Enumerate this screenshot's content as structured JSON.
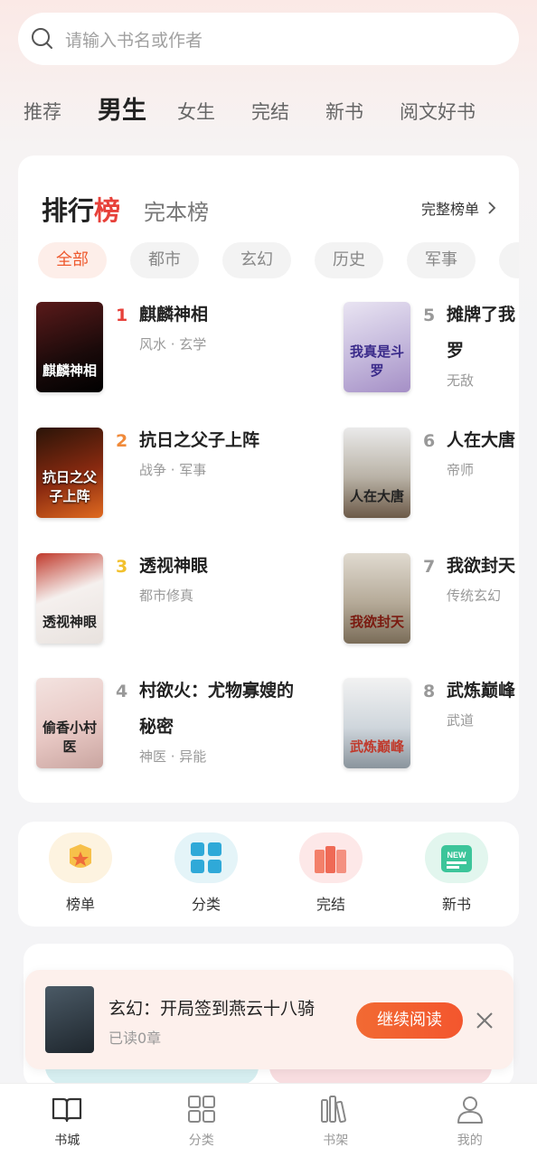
{
  "search": {
    "placeholder": "请输入书名或作者"
  },
  "top_tabs": [
    "推荐",
    "男生",
    "女生",
    "完结",
    "新书",
    "阅文好书"
  ],
  "active_top_tab": "男生",
  "ranking": {
    "title_prefix": "排行",
    "title_accent": "榜",
    "subtitle": "完本榜",
    "full_list_label": "完整榜单",
    "chips": [
      "全部",
      "都市",
      "玄幻",
      "历史",
      "军事"
    ],
    "active_chip": "全部",
    "books": [
      {
        "rank": "1",
        "title": "麒麟神相",
        "tags": "风水 · 玄学",
        "cover_text": "麒麟神相"
      },
      {
        "rank": "2",
        "title": "抗日之父子上阵",
        "tags": "战争 · 军事",
        "cover_text": "抗日之父子上阵"
      },
      {
        "rank": "3",
        "title": "透视神眼",
        "tags": "都市修真",
        "cover_text": "透视神眼"
      },
      {
        "rank": "4",
        "title": "村欲火：尤物寡嫂的",
        "title2": "秘密",
        "tags": "神医 · 异能",
        "cover_text": "偷香小村医"
      },
      {
        "rank": "5",
        "title": "摊牌了我",
        "title2": "罗",
        "tags": "无敌",
        "cover_text": "我真是斗罗"
      },
      {
        "rank": "6",
        "title": "人在大唐",
        "tags": "帝师",
        "cover_text": "人在大唐"
      },
      {
        "rank": "7",
        "title": "我欲封天",
        "tags": "传统玄幻",
        "cover_text": "我欲封天"
      },
      {
        "rank": "8",
        "title": "武炼巅峰",
        "tags": "武道",
        "cover_text": "武炼巅峰"
      }
    ],
    "rank_colors": [
      "#e7413a",
      "#f08a3a",
      "#f2c12e",
      "#999999"
    ]
  },
  "quick_entries": [
    {
      "label": "榜单",
      "icon": "crown-badge-icon"
    },
    {
      "label": "分类",
      "icon": "grid-icon"
    },
    {
      "label": "完结",
      "icon": "books-icon"
    },
    {
      "label": "新书",
      "icon": "new-card-icon"
    }
  ],
  "continue_reading": {
    "title": "玄幻：开局签到燕云十八骑",
    "progress": "已读0章",
    "button_label": "继续阅读"
  },
  "bottom_tabs": [
    {
      "label": "书城",
      "icon": "book-open-icon"
    },
    {
      "label": "分类",
      "icon": "grid-icon"
    },
    {
      "label": "书架",
      "icon": "bookshelf-icon"
    },
    {
      "label": "我的",
      "icon": "person-icon"
    }
  ],
  "active_bottom_tab": "书城",
  "colors": {
    "accent": "#f2602f",
    "rank_red": "#e7413a"
  }
}
